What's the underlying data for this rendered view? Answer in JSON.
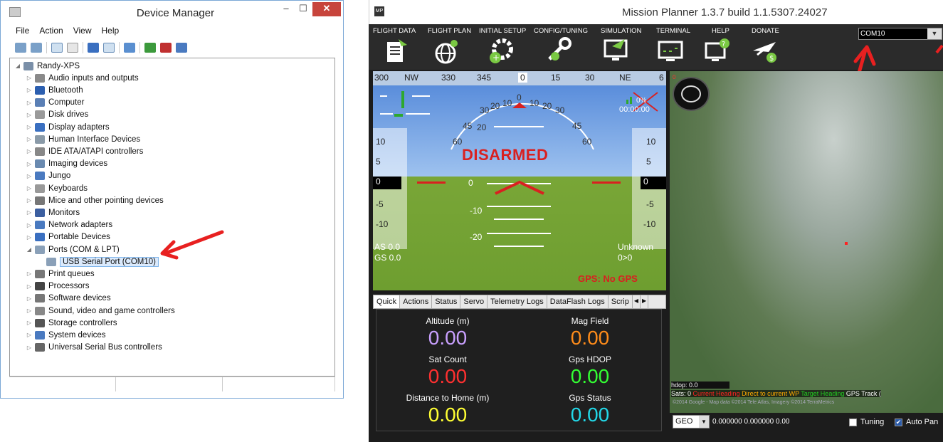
{
  "device_manager": {
    "title": "Device Manager",
    "menu": [
      "File",
      "Action",
      "View",
      "Help"
    ],
    "tree": [
      {
        "label": "Randy-XPS",
        "level": 0,
        "expanded": true
      },
      {
        "label": "Audio inputs and outputs",
        "level": 1
      },
      {
        "label": "Bluetooth",
        "level": 1
      },
      {
        "label": "Computer",
        "level": 1
      },
      {
        "label": "Disk drives",
        "level": 1
      },
      {
        "label": "Display adapters",
        "level": 1
      },
      {
        "label": "Human Interface Devices",
        "level": 1
      },
      {
        "label": "IDE ATA/ATAPI controllers",
        "level": 1
      },
      {
        "label": "Imaging devices",
        "level": 1
      },
      {
        "label": "Jungo",
        "level": 1
      },
      {
        "label": "Keyboards",
        "level": 1
      },
      {
        "label": "Mice and other pointing devices",
        "level": 1
      },
      {
        "label": "Monitors",
        "level": 1
      },
      {
        "label": "Network adapters",
        "level": 1
      },
      {
        "label": "Portable Devices",
        "level": 1
      },
      {
        "label": "Ports (COM & LPT)",
        "level": 1,
        "expanded": true
      },
      {
        "label": "USB Serial Port (COM10)",
        "level": 2,
        "selected": true
      },
      {
        "label": "Print queues",
        "level": 1
      },
      {
        "label": "Processors",
        "level": 1
      },
      {
        "label": "Software devices",
        "level": 1
      },
      {
        "label": "Sound, video and game controllers",
        "level": 1
      },
      {
        "label": "Storage controllers",
        "level": 1
      },
      {
        "label": "System devices",
        "level": 1
      },
      {
        "label": "Universal Serial Bus controllers",
        "level": 1
      }
    ]
  },
  "mission_planner": {
    "title": "Mission Planner 1.3.7 build 1.1.5307.24027",
    "nav": [
      "FLIGHT DATA",
      "FLIGHT PLAN",
      "INITIAL SETUP",
      "CONFIG/TUNING",
      "SIMULATION",
      "TERMINAL",
      "HELP",
      "DONATE"
    ],
    "com_port": "COM10",
    "hud": {
      "heading_ticks": [
        "300",
        "NW",
        "330",
        "345",
        "0",
        "15",
        "30",
        "NE",
        "6"
      ],
      "status": "DISARMED",
      "pitch_labels": [
        "20",
        "0",
        "-10",
        "-20"
      ],
      "roll_labels": [
        "60",
        "45",
        "30",
        "20",
        "10",
        "0",
        "10",
        "20",
        "30",
        "45",
        "60"
      ],
      "left_tape": [
        "10",
        "5",
        "0",
        "-5",
        "-10"
      ],
      "right_tape": [
        "10",
        "5",
        "0",
        "-5",
        "-10"
      ],
      "airspeed": "AS 0.0",
      "groundspeed": "GS 0.0",
      "mode": "Unknown",
      "wp": "0>0",
      "gps": "GPS: No GPS",
      "battery": "0%",
      "timer": "00:00:00",
      "left_marker": "0"
    },
    "tabs": [
      "Quick",
      "Actions",
      "Status",
      "Servo",
      "Telemetry Logs",
      "DataFlash Logs",
      "Scrip"
    ],
    "quick": [
      {
        "label": "Altitude (m)",
        "value": "0.00",
        "color": "#c9a0ff"
      },
      {
        "label": "Mag Field",
        "value": "0.00",
        "color": "#ff8c1a"
      },
      {
        "label": "Sat Count",
        "value": "0.00",
        "color": "#ff3030"
      },
      {
        "label": "Gps HDOP",
        "value": "0.00",
        "color": "#33ff33"
      },
      {
        "label": "Distance to Home (m)",
        "value": "0.00",
        "color": "#ffff33"
      },
      {
        "label": "Gps Status",
        "value": "0.00",
        "color": "#22d8e8"
      }
    ],
    "map": {
      "hdop": "hdop: 0.0",
      "sats": "Sats: 0",
      "legend": [
        "Current Heading",
        "Direct to current WP",
        "Target Heading",
        "GPS Track ("
      ],
      "legend_colors": [
        "#ff2222",
        "#ffaa00",
        "#22cc22",
        "#ffffff"
      ],
      "copyright": "©2014 Google - Map data ©2014 Tele Atlas, Imagery ©2014 TerraMetrics",
      "geo": "GEO",
      "coords": "0.000000 0.000000     0.00",
      "tuning": "Tuning",
      "auto_pan": "Auto Pan"
    }
  }
}
